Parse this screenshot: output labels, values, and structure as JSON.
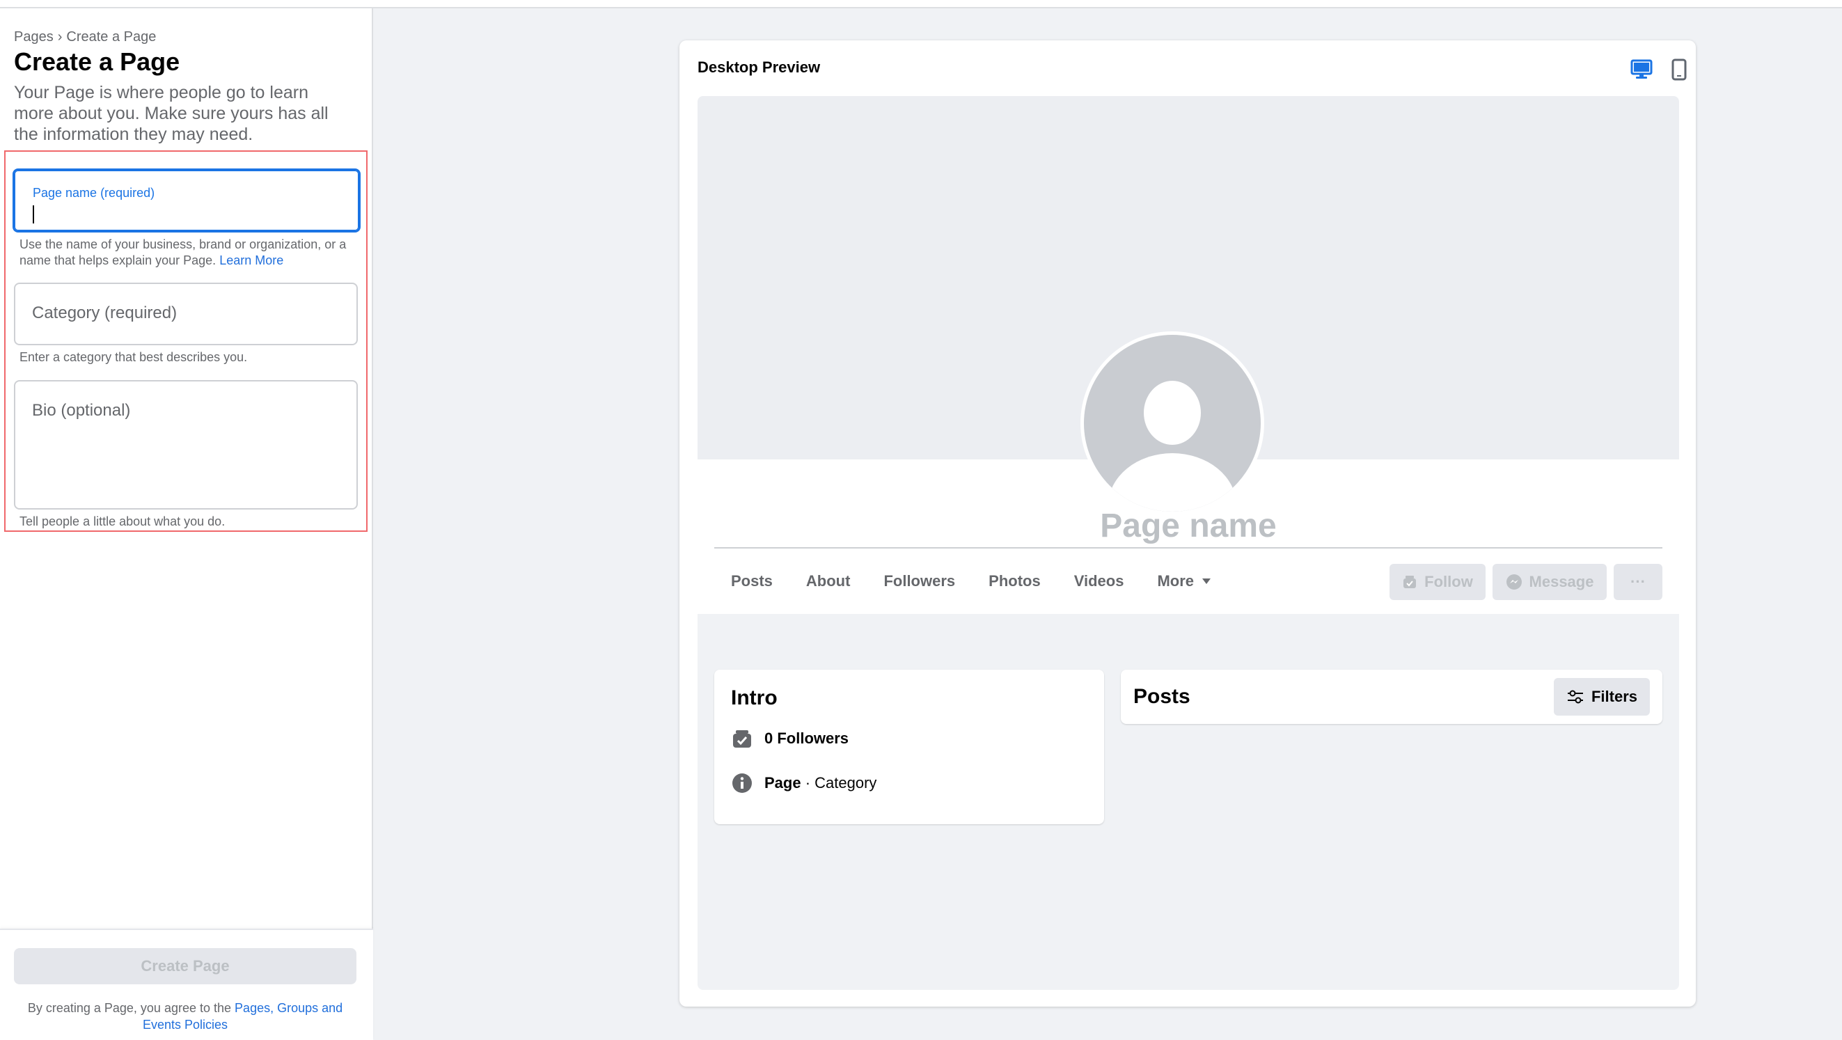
{
  "breadcrumb": {
    "root": "Pages",
    "separator": "›",
    "current": "Create a Page"
  },
  "title": "Create a Page",
  "description": "Your Page is where people go to learn more about you. Make sure yours has all the information they may need.",
  "form": {
    "page_name": {
      "label": "Page name (required)",
      "value": "",
      "helper_text": "Use the name of your business, brand or organization, or a name that helps explain your Page.",
      "helper_link": "Learn More"
    },
    "category": {
      "placeholder": "Category (required)",
      "helper_text": "Enter a category that best describes you."
    },
    "bio": {
      "placeholder": "Bio (optional)",
      "helper_text": "Tell people a little about what you do."
    }
  },
  "footer": {
    "create_button": "Create Page",
    "terms_prefix": "By creating a Page, you agree to the",
    "terms_link": "Pages, Groups and Events Policies"
  },
  "preview": {
    "title": "Desktop Preview",
    "devices": [
      "desktop-icon",
      "mobile-icon"
    ],
    "page_name": "Page name",
    "tabs": [
      "Posts",
      "About",
      "Followers",
      "Photos",
      "Videos",
      "More"
    ],
    "actions": {
      "follow": "Follow",
      "message": "Message",
      "more": "···"
    },
    "intro": {
      "title": "Intro",
      "followers": "0 Followers",
      "page_label": "Page",
      "category_sep": " · ",
      "category": "Category"
    },
    "posts": {
      "title": "Posts",
      "filters": "Filters"
    }
  },
  "colors": {
    "accent": "#1b74e4",
    "link": "#216fdb",
    "highlight_border": "#f0686b",
    "disabled_text": "#bcc0c4"
  }
}
